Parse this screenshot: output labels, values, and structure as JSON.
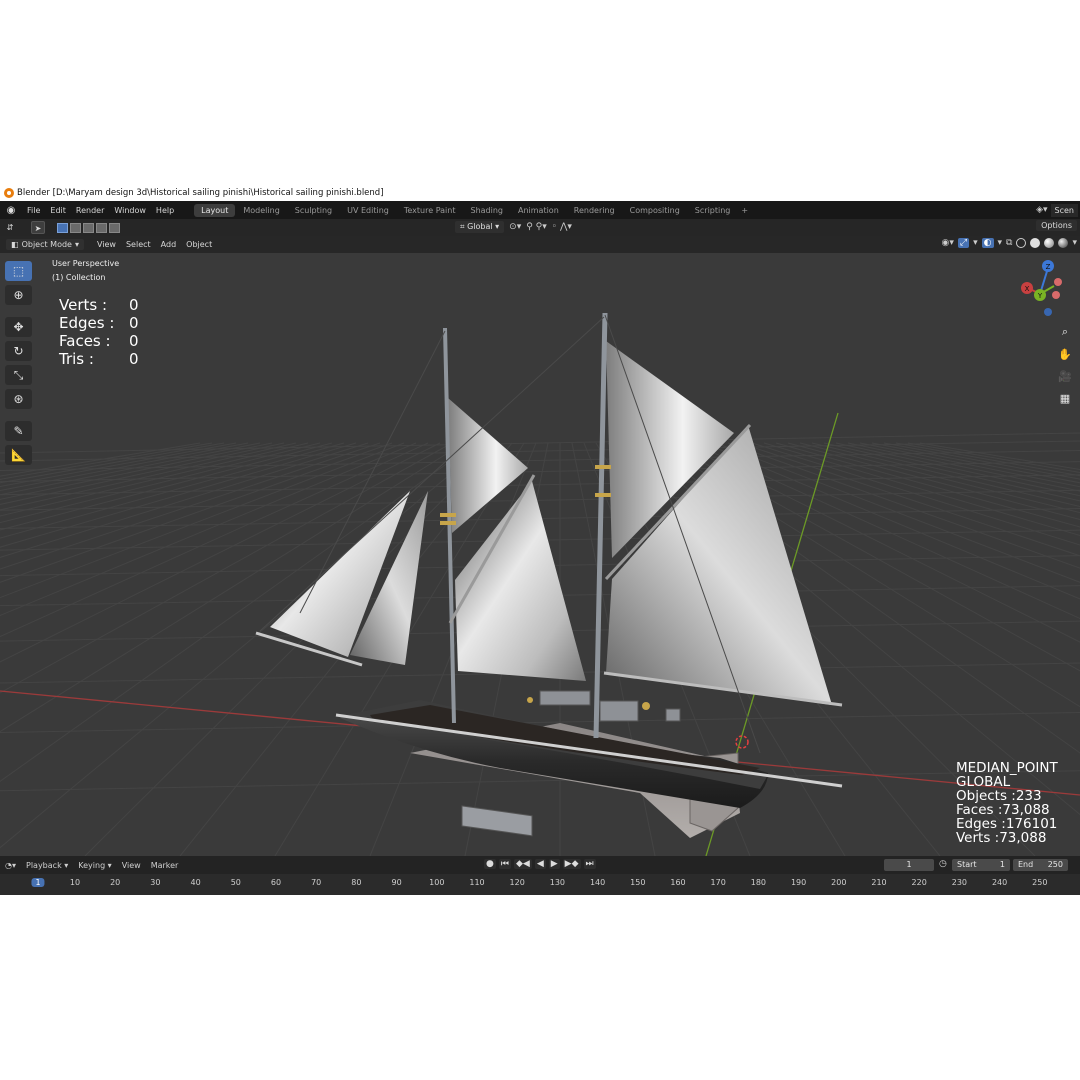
{
  "window": {
    "title": "Blender [D:\\Maryam design 3d\\Historical sailing pinishi\\Historical sailing pinishi.blend]"
  },
  "menubar": {
    "menus": [
      "File",
      "Edit",
      "Render",
      "Window",
      "Help"
    ],
    "workspaces": [
      "Layout",
      "Modeling",
      "Sculpting",
      "UV Editing",
      "Texture Paint",
      "Shading",
      "Animation",
      "Rendering",
      "Compositing",
      "Scripting"
    ],
    "active_workspace": "Layout",
    "scene_label": "Scen"
  },
  "toolheader": {
    "orientation": "Global",
    "options": "Options"
  },
  "viewport_header": {
    "mode": "Object Mode",
    "menus": [
      "View",
      "Select",
      "Add",
      "Object"
    ]
  },
  "viewport": {
    "view_name": "User Perspective",
    "collection": "(1) Collection",
    "stats_left": [
      {
        "label": "Verts :",
        "value": "0"
      },
      {
        "label": "Edges :",
        "value": "0"
      },
      {
        "label": "Faces :",
        "value": "0"
      },
      {
        "label": "Tris :",
        "value": "0"
      }
    ],
    "stats_right": [
      "MEDIAN_POINT",
      "GLOBAL",
      "Objects :233",
      "Faces :73,088",
      "Edges :176101",
      "Verts :73,088"
    ]
  },
  "gizmo": {
    "x_label": "X",
    "y_label": "Y",
    "z_label": "Z"
  },
  "timeline": {
    "menus": [
      "Playback",
      "Keying",
      "View",
      "Marker"
    ],
    "current_frame": "1",
    "start_label": "Start",
    "start_value": "1",
    "end_label": "End",
    "end_value": "250",
    "ruler_current": "1",
    "ruler_ticks": [
      "10",
      "20",
      "30",
      "40",
      "50",
      "60",
      "70",
      "80",
      "90",
      "100",
      "110",
      "120",
      "130",
      "140",
      "150",
      "160",
      "170",
      "180",
      "190",
      "200",
      "210",
      "220",
      "230",
      "240",
      "250"
    ]
  },
  "colors": {
    "accent": "#4772b3",
    "x_axis": "#c84040",
    "y_axis": "#7ab324",
    "z_axis": "#3c78d8"
  }
}
